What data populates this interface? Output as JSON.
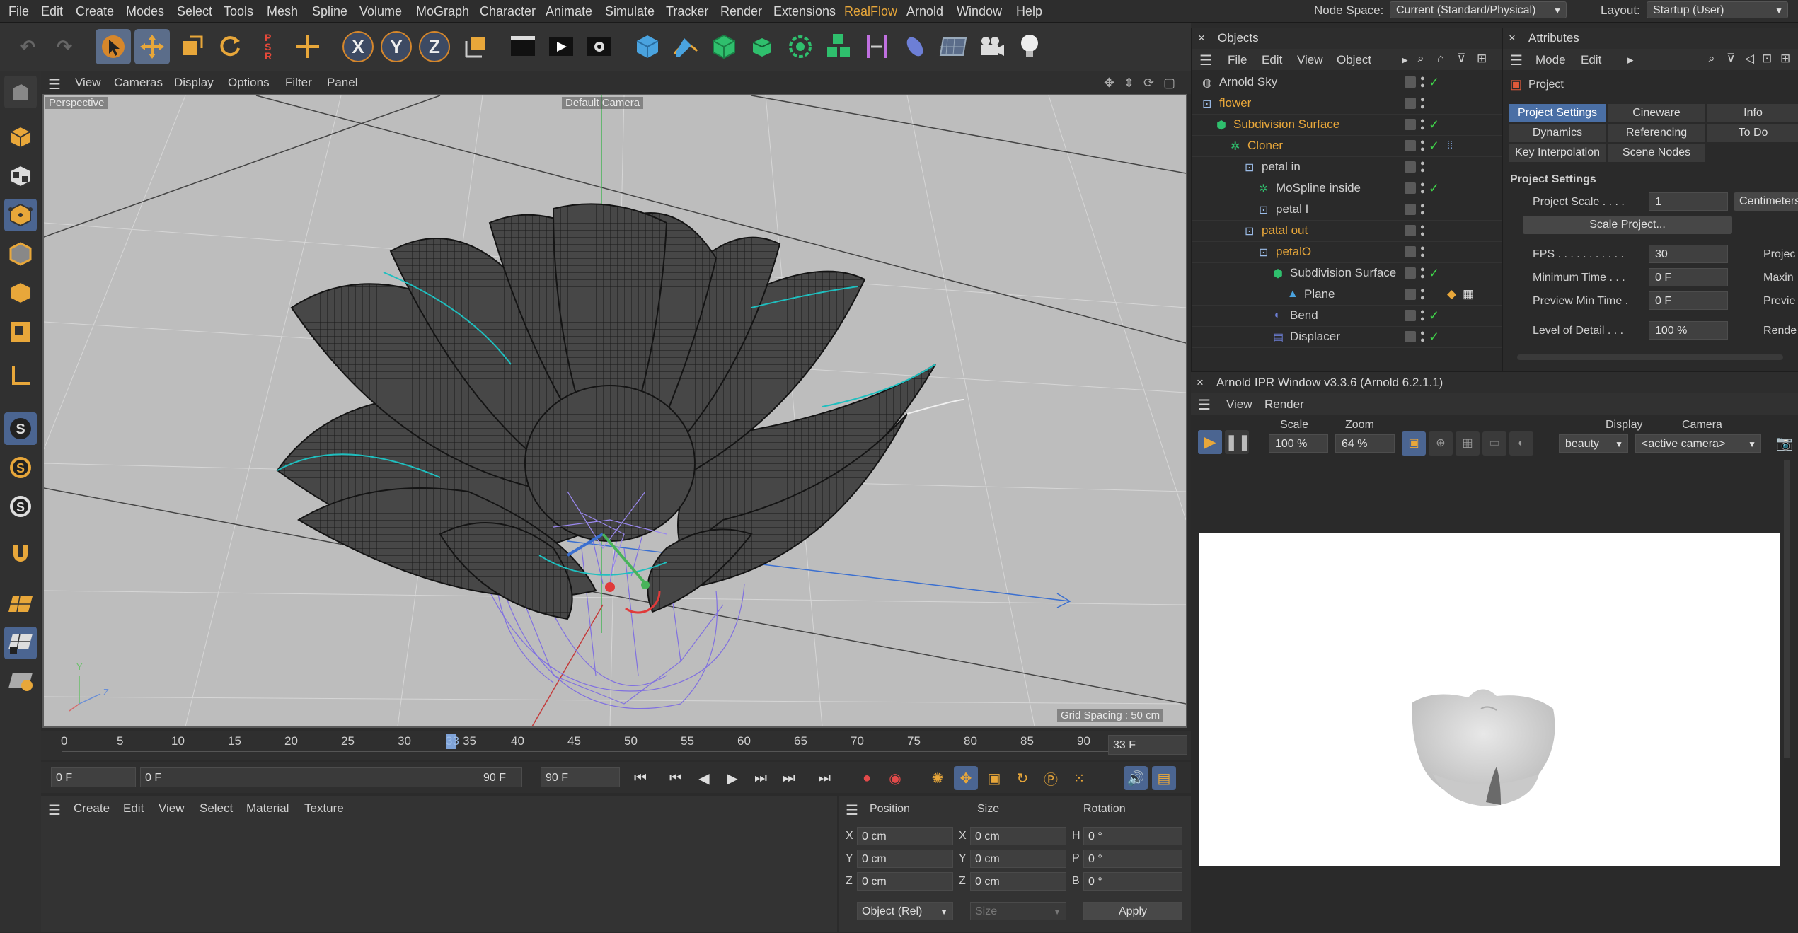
{
  "menubar": {
    "items": [
      "File",
      "Edit",
      "Create",
      "Modes",
      "Select",
      "Tools",
      "Mesh",
      "Spline",
      "Volume",
      "MoGraph",
      "Character",
      "Animate",
      "Simulate",
      "Tracker",
      "Render",
      "Extensions",
      "RealFlow",
      "Arnold",
      "Window",
      "Help"
    ],
    "node_space_label": "Node Space:",
    "node_space_value": "Current (Standard/Physical)",
    "layout_label": "Layout:",
    "layout_value": "Startup (User)"
  },
  "toolbar": {
    "axis_x": "X",
    "axis_y": "Y",
    "axis_z": "Z"
  },
  "viewport": {
    "menu": [
      "View",
      "Cameras",
      "Display",
      "Options",
      "Filter",
      "Panel"
    ],
    "view_name": "Perspective",
    "camera_name": "Default Camera",
    "grid_spacing": "Grid Spacing : 50 cm",
    "axis_y": "Y",
    "axis_z": "Z"
  },
  "timeline": {
    "ticks": [
      "0",
      "5",
      "10",
      "15",
      "20",
      "25",
      "30",
      "33",
      "35",
      "40",
      "45",
      "50",
      "55",
      "60",
      "65",
      "70",
      "75",
      "80",
      "85",
      "90"
    ],
    "current_frame": "33 F",
    "playhead_fraction": 0.3667
  },
  "transport": {
    "start": "0 F",
    "range_start": "0 F",
    "range_end": "90 F",
    "end": "90 F"
  },
  "material_manager": {
    "menu": [
      "Create",
      "Edit",
      "View",
      "Select",
      "Material",
      "Texture"
    ]
  },
  "coordinates": {
    "headers": [
      "Position",
      "Size",
      "Rotation"
    ],
    "rows": [
      {
        "axis": "X",
        "pos": "0 cm",
        "size_axis": "X",
        "size": "0 cm",
        "rot_axis": "H",
        "rot": "0 °"
      },
      {
        "axis": "Y",
        "pos": "0 cm",
        "size_axis": "Y",
        "size": "0 cm",
        "rot_axis": "P",
        "rot": "0 °"
      },
      {
        "axis": "Z",
        "pos": "0 cm",
        "size_axis": "Z",
        "size": "0 cm",
        "rot_axis": "B",
        "rot": "0 °"
      }
    ],
    "mode": "Object (Rel)",
    "size_mode": "Size",
    "apply": "Apply"
  },
  "objects": {
    "title": "Objects",
    "menu": [
      "File",
      "Edit",
      "View",
      "Object"
    ],
    "items": [
      {
        "name": "Arnold Sky",
        "indent": 0,
        "accent": false,
        "check": true
      },
      {
        "name": "flower",
        "indent": 0,
        "accent": true,
        "check": false
      },
      {
        "name": "Subdivision Surface",
        "indent": 1,
        "accent": true,
        "check": true
      },
      {
        "name": "Cloner",
        "indent": 2,
        "accent": true,
        "check": true
      },
      {
        "name": "petal in",
        "indent": 3,
        "accent": false,
        "check": false
      },
      {
        "name": "MoSpline inside",
        "indent": 4,
        "accent": false,
        "check": true
      },
      {
        "name": "petal I",
        "indent": 4,
        "accent": false,
        "check": false
      },
      {
        "name": "patal out",
        "indent": 3,
        "accent": true,
        "check": false
      },
      {
        "name": "petalO",
        "indent": 4,
        "accent": true,
        "check": false
      },
      {
        "name": "Subdivision Surface",
        "indent": 5,
        "accent": false,
        "check": true
      },
      {
        "name": "Plane",
        "indent": 6,
        "accent": false,
        "check": false
      },
      {
        "name": "Bend",
        "indent": 5,
        "accent": false,
        "check": true
      },
      {
        "name": "Displacer",
        "indent": 5,
        "accent": false,
        "check": true
      }
    ]
  },
  "attributes": {
    "title": "Attributes",
    "menu": [
      "Mode",
      "Edit"
    ],
    "object": "Project",
    "tabs_row1": [
      "Project Settings",
      "Cineware",
      "Info"
    ],
    "tabs_row2": [
      "Dynamics",
      "Referencing",
      "To Do"
    ],
    "tabs_row3": [
      "Key Interpolation",
      "Scene Nodes"
    ],
    "section": "Project Settings",
    "project_scale_label": "Project Scale . . . .",
    "project_scale_value": "1",
    "project_scale_unit": "Centimeters",
    "scale_project_button": "Scale Project...",
    "fps_label": "FPS . . . . . . . . . . .",
    "fps_value": "30",
    "fps_right": "Projec",
    "min_time_label": "Minimum Time . . .",
    "min_time_value": "0 F",
    "min_time_right": "Maxin",
    "preview_min_label": "Preview Min Time .",
    "preview_min_value": "0 F",
    "preview_min_right": "Previe",
    "lod_label": "Level of Detail . . .",
    "lod_value": "100 %",
    "lod_right": "Rende"
  },
  "ipr": {
    "title": "Arnold IPR Window v3.3.6 (Arnold 6.2.1.1)",
    "menu": [
      "View",
      "Render"
    ],
    "scale_label": "Scale",
    "scale_value": "100 %",
    "zoom_label": "Zoom",
    "zoom_value": "64 %",
    "display_label": "Display",
    "display_value": "beauty",
    "camera_label": "Camera",
    "camera_value": "<active camera>"
  }
}
